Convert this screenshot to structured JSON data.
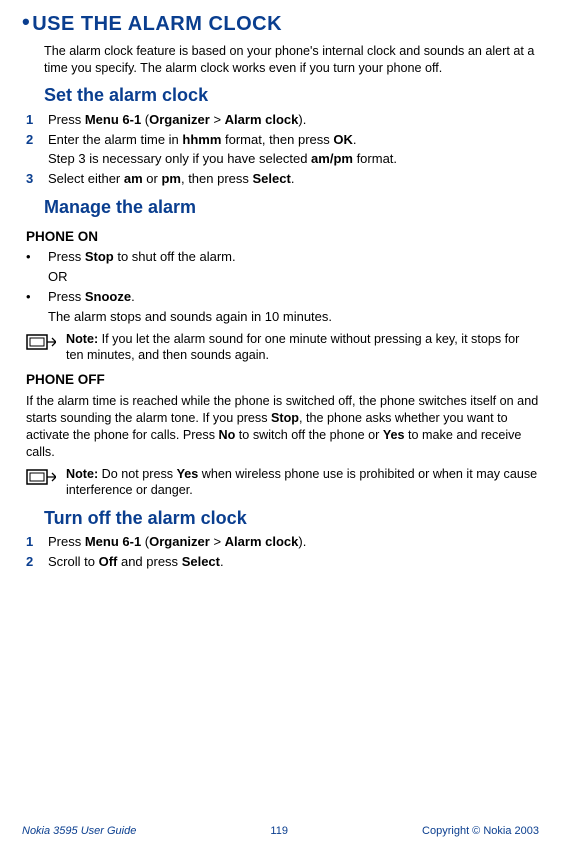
{
  "h1": "USE THE ALARM CLOCK",
  "intro": "The alarm clock feature is based on your phone's internal clock and sounds an alert at a time you specify. The alarm clock works even if you turn your phone off.",
  "set": {
    "title": "Set the alarm clock",
    "steps": [
      {
        "num": "1",
        "pre": "Press ",
        "b1": "Menu 6-1",
        "mid": " (",
        "b2": "Organizer",
        "gt": " > ",
        "b3": "Alarm clock",
        "post": ")."
      },
      {
        "num": "2",
        "pre": "Enter the alarm time in ",
        "b1": "hhmm",
        "mid": " format, then press ",
        "b2": "OK",
        "post": "."
      },
      {
        "num": "3",
        "pre": "Select either ",
        "b1": "am",
        "mid": " or ",
        "b2": "pm",
        "mid2": ", then press ",
        "b3": "Select",
        "post": "."
      }
    ],
    "sub": {
      "pre": "Step 3 is necessary only if you have selected ",
      "b": "am/pm",
      "post": " format."
    }
  },
  "manage": {
    "title": "Manage the alarm",
    "on_h": "PHONE ON",
    "on_b1": {
      "pre": "Press ",
      "b": "Stop",
      "post": " to shut off the alarm."
    },
    "or": "OR",
    "on_b2": {
      "pre": "Press ",
      "b": "Snooze",
      "post": "."
    },
    "on_sub": "The alarm stops and sounds again in 10 minutes.",
    "note1": {
      "b": "Note:",
      "t": " If you let the alarm sound for one minute without pressing a key, it stops for ten minutes, and then sounds again."
    },
    "off_h": "PHONE OFF",
    "off_p": {
      "p1": "If the alarm time is reached while the phone is switched off, the phone switches itself on and starts sounding the alarm tone. If you press ",
      "b1": "Stop",
      "p2": ", the phone asks whether you want to activate the phone for calls. Press ",
      "b2": "No",
      "p3": " to switch off the phone or ",
      "b3": "Yes",
      "p4": " to make and receive calls."
    },
    "note2": {
      "b": "Note:",
      "t1": " Do not press ",
      "by": "Yes",
      "t2": " when wireless phone use is prohibited or when it may cause interference or danger."
    }
  },
  "turnoff": {
    "title": "Turn off the alarm clock",
    "steps": [
      {
        "num": "1",
        "pre": "Press ",
        "b1": "Menu 6-1",
        "mid": " (",
        "b2": "Organizer",
        "gt": " > ",
        "b3": "Alarm clock",
        "post": ")."
      },
      {
        "num": "2",
        "pre": "Scroll to ",
        "b1": "Off",
        "mid": " and press ",
        "b2": "Select",
        "post": "."
      }
    ]
  },
  "footer": {
    "left": "Nokia 3595 User Guide",
    "mid": "119",
    "right": "Copyright © Nokia 2003"
  }
}
